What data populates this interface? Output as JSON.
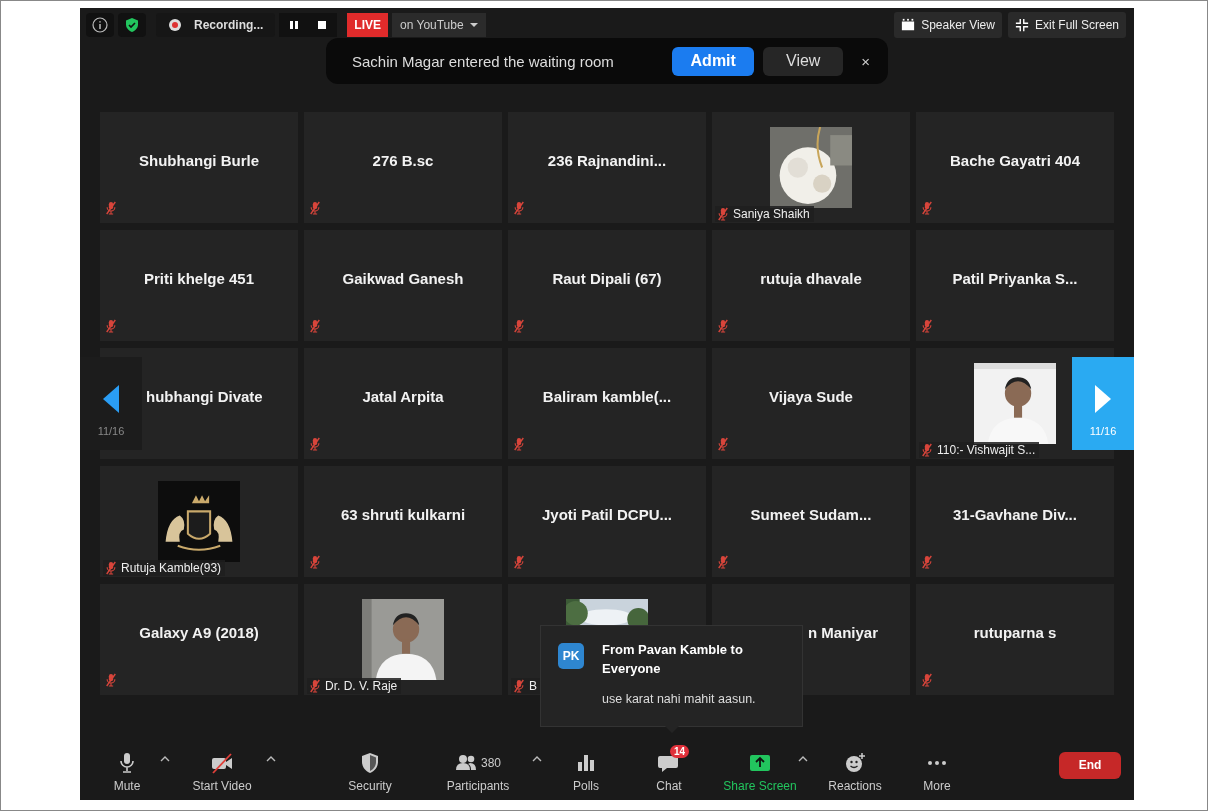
{
  "meeting_bar": {
    "recording_label": "Recording...",
    "live_label": "LIVE",
    "stream_target": "on YouTube"
  },
  "view_buttons": [
    {
      "label": "Speaker View",
      "kind": "speaker"
    },
    {
      "label": "Exit Full Screen",
      "kind": "exit"
    }
  ],
  "waiting_room_toast": {
    "message": "Sachin Magar entered the waiting room",
    "buttons": [
      {
        "label": "Admit",
        "kind": "primary"
      },
      {
        "label": "View",
        "kind": "secondary"
      }
    ],
    "close": "×"
  },
  "pager": {
    "previous": "11/16",
    "next": "11/16"
  },
  "tiles": [
    {
      "kind": "name",
      "name": "Shubhangi Burle",
      "muted": true
    },
    {
      "kind": "name",
      "name": "276 B.sc",
      "muted": true
    },
    {
      "kind": "name",
      "name": "236 Rajnandini...",
      "muted": true
    },
    {
      "kind": "picture",
      "name": "Saniya Shaikh",
      "muted": true
    },
    {
      "kind": "name",
      "name": "Bache Gayatri 404",
      "muted": true
    },
    {
      "kind": "name",
      "name": "Priti khelge 451",
      "muted": true
    },
    {
      "kind": "name",
      "name": "Gaikwad Ganesh",
      "muted": true
    },
    {
      "kind": "name",
      "name": "Raut Dipali (67)",
      "muted": true
    },
    {
      "kind": "name",
      "name": "rutuja dhavale",
      "muted": true
    },
    {
      "kind": "name",
      "name": "Patil Priyanka S...",
      "muted": true
    },
    {
      "kind": "covered-left",
      "name": "hubhangi Divate"
    },
    {
      "kind": "name",
      "name": "Jatal Arpita",
      "muted": true
    },
    {
      "kind": "name",
      "name": "Baliram kamble(...",
      "muted": true
    },
    {
      "kind": "name",
      "name": "Vijaya Sude",
      "muted": true
    },
    {
      "kind": "picture",
      "name": "110:- Vishwajit S...",
      "muted": true
    },
    {
      "kind": "picture",
      "name": "Rutuja Kamble(93)",
      "muted": true
    },
    {
      "kind": "name",
      "name": "63 shruti kulkarni",
      "muted": true
    },
    {
      "kind": "name",
      "name": "Jyoti Patil DCPU...",
      "muted": true
    },
    {
      "kind": "name",
      "name": "Sumeet Sudam...",
      "muted": true
    },
    {
      "kind": "name",
      "name": "31-Gavhane Div...",
      "muted": true
    },
    {
      "kind": "name",
      "name": "Galaxy A9 (2018)",
      "muted": true
    },
    {
      "kind": "picture",
      "name": "Dr. D. V. Raje",
      "muted": true
    },
    {
      "kind": "picture",
      "name": "B",
      "muted": true
    },
    {
      "kind": "covered-left",
      "name": "n Maniyar"
    },
    {
      "kind": "name",
      "name": "rutuparna s",
      "muted": true
    }
  ],
  "chat_popup": {
    "avatar": "PK",
    "sender": "From Pavan Kamble to Everyone",
    "message": "use karat nahi mahit aasun."
  },
  "toolbar": {
    "items": [
      {
        "kind": "mic",
        "label": "Mute",
        "caret": true
      },
      {
        "kind": "video",
        "label": "Start Video",
        "caret": true
      },
      {
        "kind": "security",
        "label": "Security",
        "caret": false
      },
      {
        "kind": "participants",
        "label": "Participants",
        "count": "380",
        "caret": true
      },
      {
        "kind": "polls",
        "label": "Polls",
        "caret": false
      },
      {
        "kind": "chat",
        "label": "Chat",
        "badge": "14",
        "caret": false
      },
      {
        "kind": "share",
        "label": "Share Screen",
        "caret": true
      },
      {
        "kind": "reactions",
        "label": "Reactions",
        "caret": false
      },
      {
        "kind": "more",
        "label": "More",
        "caret": false
      }
    ],
    "end": "End"
  }
}
